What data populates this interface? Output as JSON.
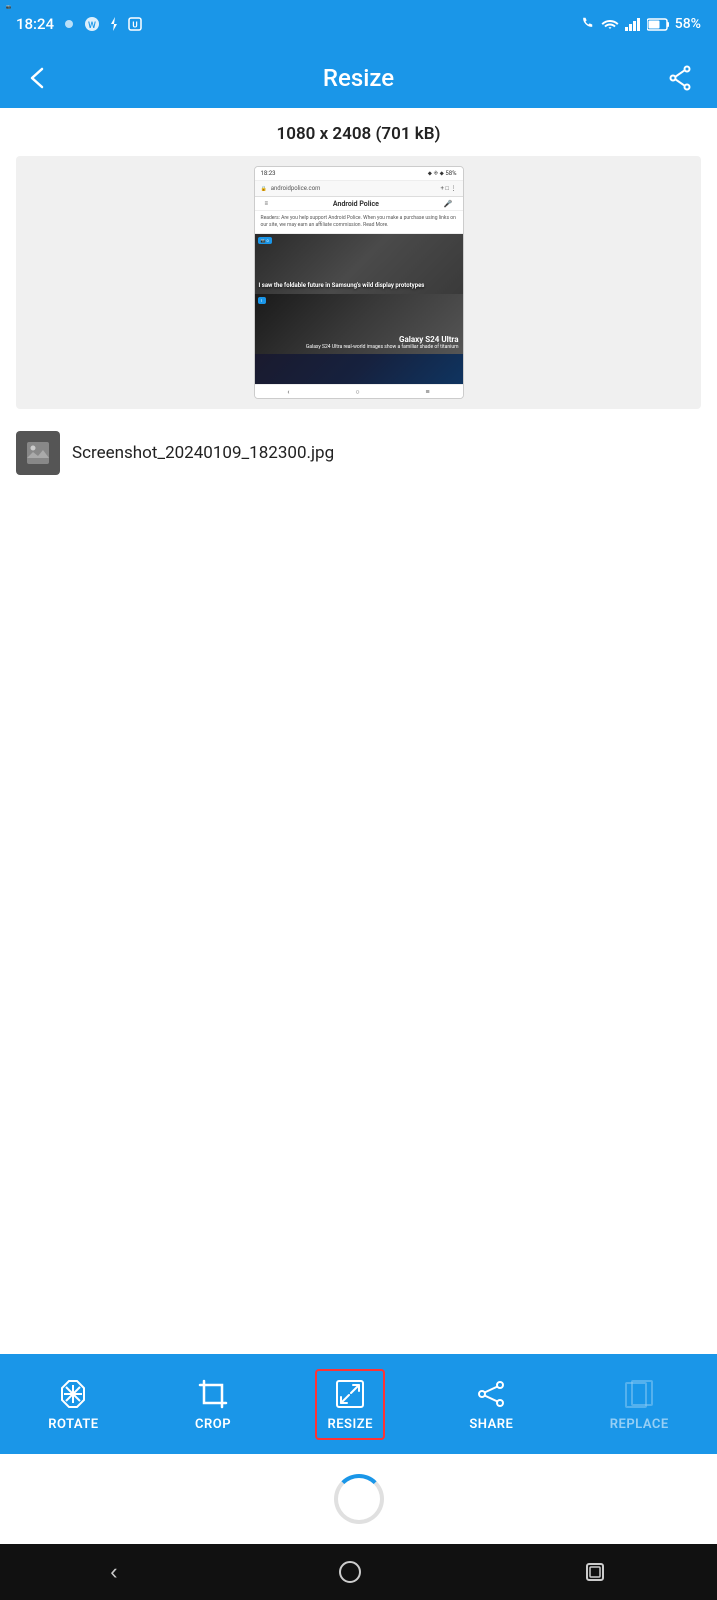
{
  "statusBar": {
    "time": "18:24",
    "battery": "58%"
  },
  "appBar": {
    "title": "Resize",
    "backLabel": "back",
    "shareLabel": "share"
  },
  "imageInfo": {
    "dimensions": "1080 x 2408 (701 kB)"
  },
  "preview": {
    "urlBarText": "androidpolice.com",
    "navLogoText": "Android Police",
    "affiliateText": "Readers: Are you help support Android Police. When you make a purchase using links on our site, we may earn an affiliate commission. Read More.",
    "card1Text": "I saw the foldable future in Samsung's wild display prototypes",
    "card2Title": "Galaxy S24 Ultra",
    "card2Text": "Galaxy S24 Ultra real-world images show a familiar shade of titanium"
  },
  "fileName": "Screenshot_20240109_182300.jpg",
  "toolbar": {
    "items": [
      {
        "id": "rotate",
        "label": "ROTATE",
        "active": false,
        "dimmed": false
      },
      {
        "id": "crop",
        "label": "CROP",
        "active": false,
        "dimmed": false
      },
      {
        "id": "resize",
        "label": "RESIZE",
        "active": true,
        "dimmed": false
      },
      {
        "id": "share",
        "label": "SHARE",
        "active": false,
        "dimmed": false
      },
      {
        "id": "replace",
        "label": "REPLACE",
        "active": false,
        "dimmed": true
      }
    ]
  }
}
